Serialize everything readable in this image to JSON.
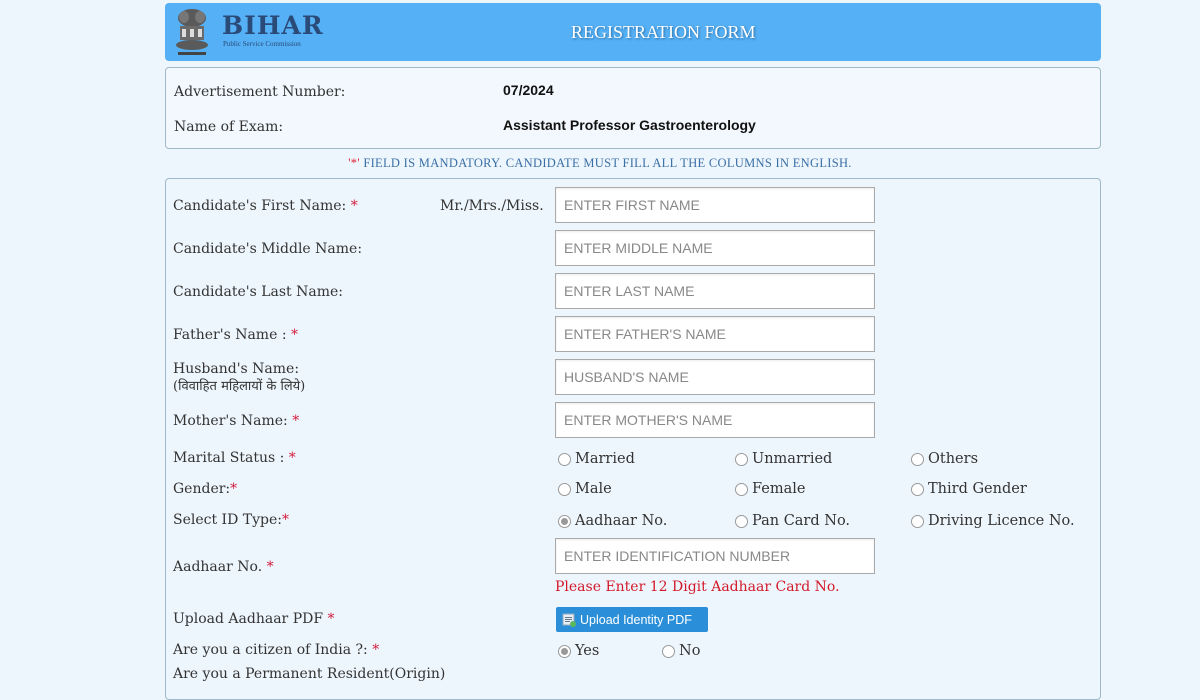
{
  "header": {
    "brand_name": "BIHAR",
    "brand_subtitle": "Public Service Commission",
    "title": "REGISTRATION FORM",
    "bg_color": "#55b0f5"
  },
  "info": {
    "advertisement_label": "Advertisement Number:",
    "advertisement_value": "07/2024",
    "exam_label": "Name of Exam:",
    "exam_value": "Assistant Professor Gastroenterology"
  },
  "notice": {
    "star": "'*'",
    "text": " FIELD IS MANDATORY. CANDIDATE MUST FILL ALL THE COLUMNS IN ENGLISH."
  },
  "form": {
    "required_marker": "*",
    "first_name": {
      "label": "Candidate's First Name:",
      "salutation": "Mr./Mrs./Miss.",
      "placeholder": "ENTER FIRST NAME",
      "value": ""
    },
    "middle_name": {
      "label": "Candidate's Middle Name:",
      "placeholder": "ENTER MIDDLE NAME",
      "value": ""
    },
    "last_name": {
      "label": "Candidate's Last Name:",
      "placeholder": "ENTER LAST NAME",
      "value": ""
    },
    "father_name": {
      "label": "Father's Name :",
      "placeholder": "ENTER FATHER'S NAME",
      "value": ""
    },
    "husband_name": {
      "label": "Husband's Name:",
      "sublabel": "(विवाहित महिलायों के लिये)",
      "placeholder": "HUSBAND'S NAME",
      "value": ""
    },
    "mother_name": {
      "label": "Mother's Name:",
      "placeholder": "ENTER MOTHER'S NAME",
      "value": ""
    },
    "marital_status": {
      "label": "Marital Status :",
      "options": [
        "Married",
        "Unmarried",
        "Others"
      ],
      "selected": null
    },
    "gender": {
      "label": "Gender:",
      "options": [
        "Male",
        "Female",
        "Third Gender"
      ],
      "selected": null
    },
    "id_type": {
      "label": "Select ID Type:",
      "options": [
        "Aadhaar No.",
        "Pan Card No.",
        "Driving Licence No."
      ],
      "selected": "Aadhaar No."
    },
    "aadhaar": {
      "label": "Aadhaar No.",
      "placeholder": "ENTER IDENTIFICATION NUMBER",
      "value": "",
      "error": "Please Enter 12 Digit Aadhaar Card No."
    },
    "upload": {
      "label": "Upload Aadhaar PDF",
      "button": "Upload Identity PDF"
    },
    "citizen": {
      "label": "Are you a citizen of India ?:",
      "options": [
        "Yes",
        "No"
      ],
      "selected": "Yes"
    },
    "next_label_partial": "Are you a Permanent Resident(Origin)"
  }
}
